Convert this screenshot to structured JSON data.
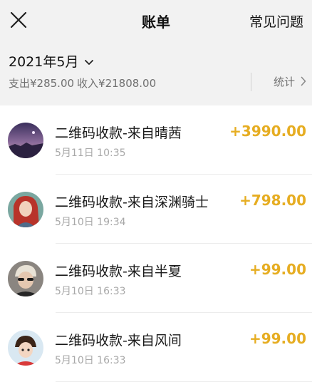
{
  "header": {
    "title": "账单",
    "faq_label": "常见问题",
    "close_icon": "close-icon"
  },
  "summary": {
    "month": "2021年5月",
    "expense": "支出¥285.00",
    "income": "收入¥21808.00",
    "stats_label": "统计"
  },
  "colors": {
    "amount": "#e6ad22",
    "background_header": "#f2f2f2"
  },
  "transactions": [
    {
      "title": "二维码收款-来自晴茜",
      "time": "5月11日 10:35",
      "amount": "+3990.00"
    },
    {
      "title": "二维码收款-来自深渊骑士",
      "time": "5月10日 19:34",
      "amount": "+798.00"
    },
    {
      "title": "二维码收款-来自半夏",
      "time": "5月10日 16:33",
      "amount": "+99.00"
    },
    {
      "title": "二维码收款-来自风间",
      "time": "5月10日 16:33",
      "amount": "+99.00"
    }
  ]
}
